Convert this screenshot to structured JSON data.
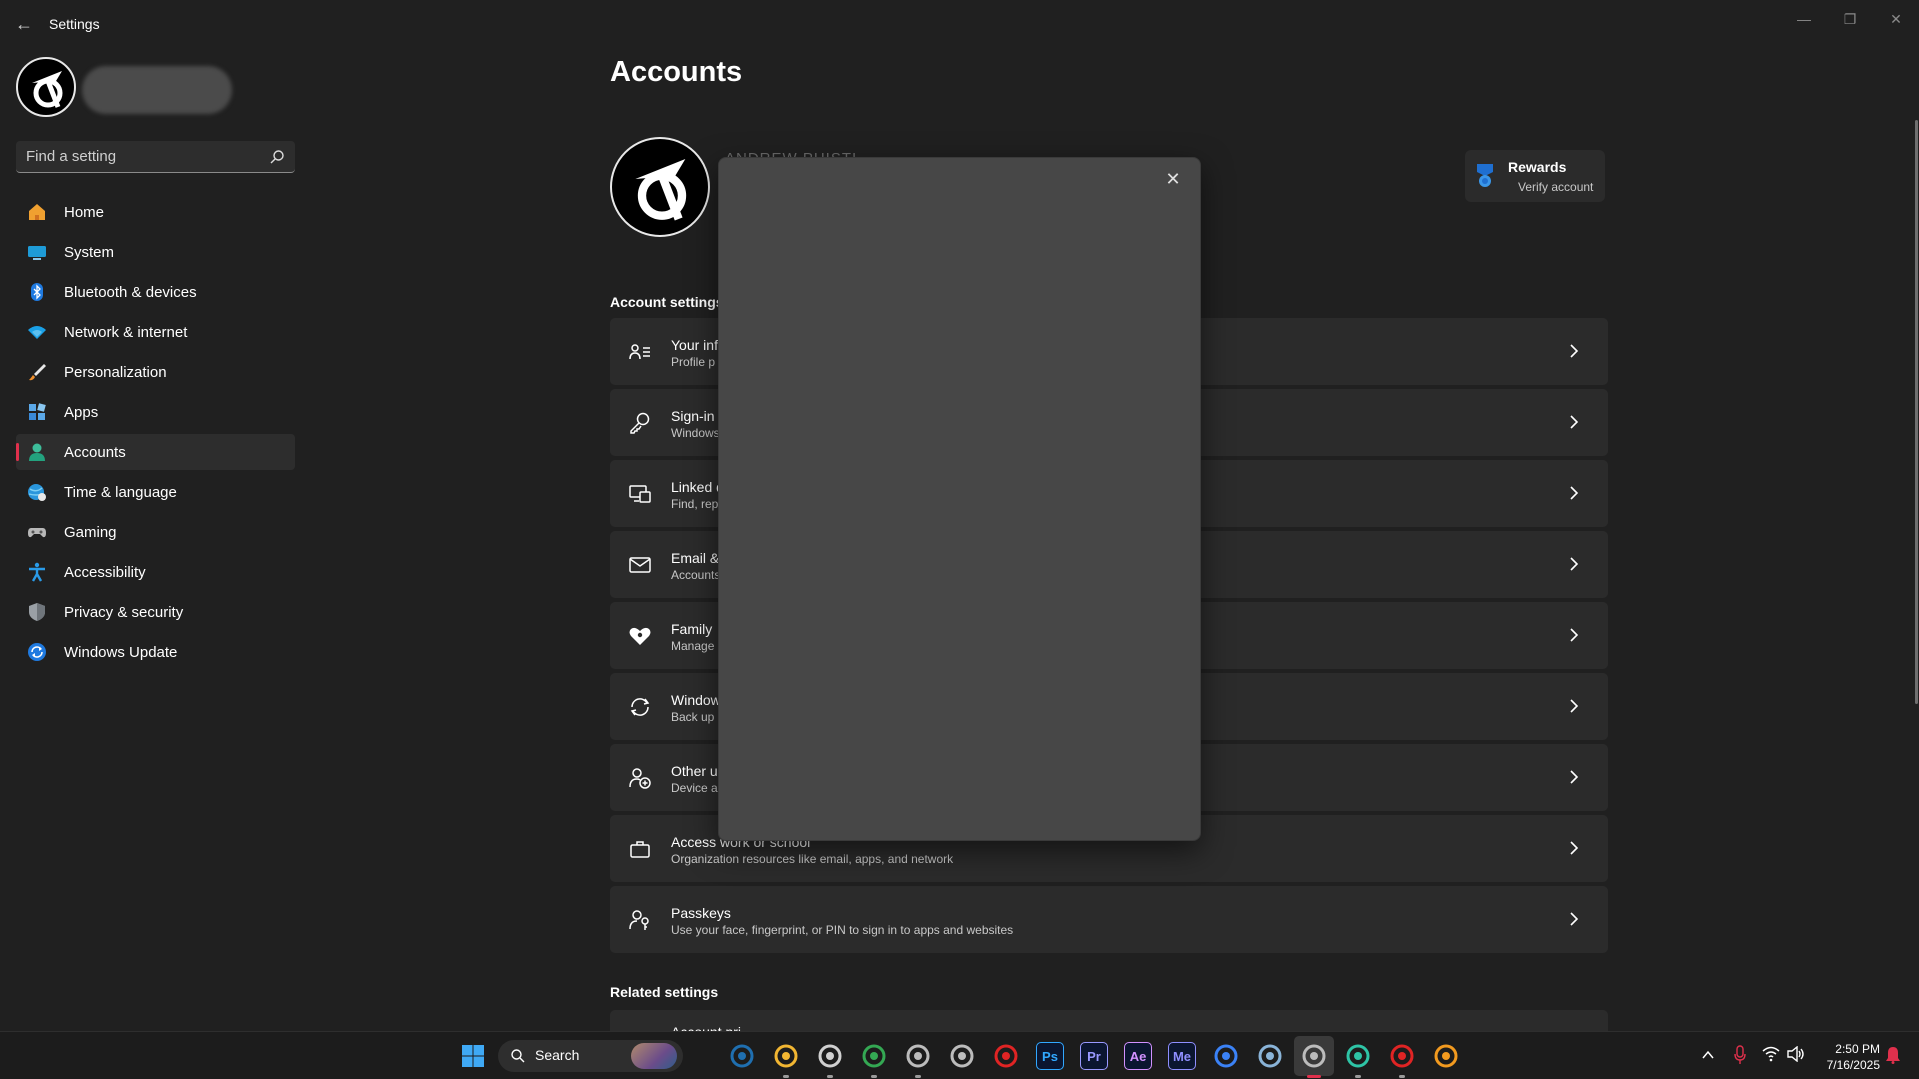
{
  "window": {
    "app_title": "Settings",
    "minimize_glyph": "—",
    "restore_glyph": "❐",
    "close_glyph": "✕",
    "back_glyph": "←"
  },
  "sidebar": {
    "search_placeholder": "Find a setting",
    "items": [
      {
        "label": "Home",
        "icon": "home-icon"
      },
      {
        "label": "System",
        "icon": "system-icon"
      },
      {
        "label": "Bluetooth & devices",
        "icon": "bluetooth-icon"
      },
      {
        "label": "Network & internet",
        "icon": "wifi-icon"
      },
      {
        "label": "Personalization",
        "icon": "brush-icon"
      },
      {
        "label": "Apps",
        "icon": "apps-icon"
      },
      {
        "label": "Accounts",
        "icon": "person-icon",
        "active": true
      },
      {
        "label": "Time & language",
        "icon": "globe-clock-icon"
      },
      {
        "label": "Gaming",
        "icon": "gamepad-icon"
      },
      {
        "label": "Accessibility",
        "icon": "accessibility-icon"
      },
      {
        "label": "Privacy & security",
        "icon": "shield-icon"
      },
      {
        "label": "Windows Update",
        "icon": "update-icon"
      }
    ]
  },
  "main": {
    "title": "Accounts",
    "profile_name": "ANDREW PHISTI",
    "rewards": {
      "title": "Rewards",
      "subtitle": "Verify account"
    },
    "account_settings_label": "Account settings",
    "related_settings_label": "Related settings",
    "rows": [
      {
        "title": "Your inf",
        "subtitle": "Profile p",
        "icon": "person-info-icon"
      },
      {
        "title": "Sign-in",
        "subtitle": "Windows",
        "icon": "key-icon"
      },
      {
        "title": "Linked d",
        "subtitle": "Find, rep",
        "icon": "linked-devices-icon"
      },
      {
        "title": "Email &",
        "subtitle": "Accounts",
        "icon": "mail-icon"
      },
      {
        "title": "Family",
        "subtitle": "Manage",
        "icon": "family-heart-icon"
      },
      {
        "title": "Window",
        "subtitle": "Back up",
        "icon": "backup-icon"
      },
      {
        "title": "Other u",
        "subtitle": "Device a",
        "icon": "add-person-icon"
      },
      {
        "title": "Access work or school",
        "subtitle": "Organization resources like email, apps, and network",
        "icon": "briefcase-icon"
      },
      {
        "title": "Passkeys",
        "subtitle": "Use your face, fingerprint, or PIN to sign in to apps and websites",
        "icon": "passkey-icon"
      }
    ],
    "partial_row_title": "Account pri"
  },
  "dialog": {
    "close_glyph": "✕"
  },
  "taskbar": {
    "search_label": "Search",
    "apps": [
      {
        "name": "photos",
        "label": "",
        "color": "#1f6fb0"
      },
      {
        "name": "file-explorer",
        "label": "",
        "color": "#f2b632"
      },
      {
        "name": "snipping-tool",
        "label": "",
        "color": "#d0d0d0"
      },
      {
        "name": "chrome",
        "label": "",
        "color": "#34a853"
      },
      {
        "name": "aperture",
        "label": "",
        "color": "#bcbcbc"
      },
      {
        "name": "remote",
        "label": "",
        "color": "#bcbcbc"
      },
      {
        "name": "record",
        "label": "",
        "color": "#e02424"
      },
      {
        "name": "photoshop",
        "label": "Ps",
        "color": "#31a8ff"
      },
      {
        "name": "premiere",
        "label": "Pr",
        "color": "#9999ff"
      },
      {
        "name": "after-effects",
        "label": "Ae",
        "color": "#d291ff"
      },
      {
        "name": "media-encoder",
        "label": "Me",
        "color": "#8f8fff"
      },
      {
        "name": "meta",
        "label": "",
        "color": "#3b82f6"
      },
      {
        "name": "steam",
        "label": "",
        "color": "#8ab4d8"
      },
      {
        "name": "settings",
        "label": "",
        "color": "#bcbcbc"
      },
      {
        "name": "edge",
        "label": "",
        "color": "#2ec4a6"
      },
      {
        "name": "davinci",
        "label": "",
        "color": "#e02424"
      },
      {
        "name": "player",
        "label": "",
        "color": "#f29a1f"
      }
    ],
    "clock_time": "2:50 PM",
    "clock_date": "7/16/2025"
  },
  "colors": {
    "accent": "#e0304c",
    "background": "#202020",
    "card": "#2b2b2b",
    "dialog": "#474747"
  }
}
